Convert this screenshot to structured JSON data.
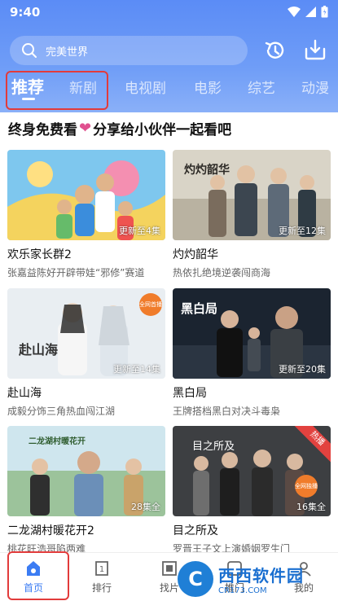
{
  "status": {
    "time": "9:40"
  },
  "search": {
    "placeholder": "完美世界"
  },
  "tabs": [
    {
      "label": "推荐"
    },
    {
      "label": "新剧"
    },
    {
      "label": "电视剧"
    },
    {
      "label": "电影"
    },
    {
      "label": "综艺"
    },
    {
      "label": "动漫"
    }
  ],
  "headline": {
    "part1": "终身免费看",
    "part2": "分享给小伙伴一起看吧"
  },
  "cards": [
    {
      "title": "欢乐家长群2",
      "sub": "张嘉益陈好开辟带娃“邪修”赛道",
      "ep": "更新至4集"
    },
    {
      "title": "灼灼韶华",
      "sub": "热依扎绝境逆袭闯商海",
      "ep": "更新至12集"
    },
    {
      "title": "赴山海",
      "sub": "成毅分饰三角热血闯江湖",
      "ep": "更新至14集",
      "badge": "全网首播"
    },
    {
      "title": "黑白局",
      "sub": "王牌搭档黑白对决斗毒枭",
      "ep": "更新至20集"
    },
    {
      "title": "二龙湖村暖花开2",
      "sub": "桃花旺浩哥陷两难",
      "ep": "28集全"
    },
    {
      "title": "目之所及",
      "sub": "罗晋王子文上演婚姻罗生门",
      "ep": "16集全",
      "ribbon": "热播",
      "badge": "全网独播"
    }
  ],
  "poster_text": {
    "p2": "灼灼韶华",
    "p3": "赴山海",
    "p4": "黑白局",
    "p5": "二龙湖村暖花开",
    "p6": "目之所及"
  },
  "nav": [
    {
      "label": "首页"
    },
    {
      "label": "排行"
    },
    {
      "label": "找片"
    },
    {
      "label": "推门"
    },
    {
      "label": "我的"
    }
  ],
  "watermark": {
    "name": "西西软件园",
    "url": "CR173.COM"
  },
  "colors": {
    "accent": "#3b7cf3",
    "header": "#6f9df7",
    "highlight": "#e23b3b"
  }
}
